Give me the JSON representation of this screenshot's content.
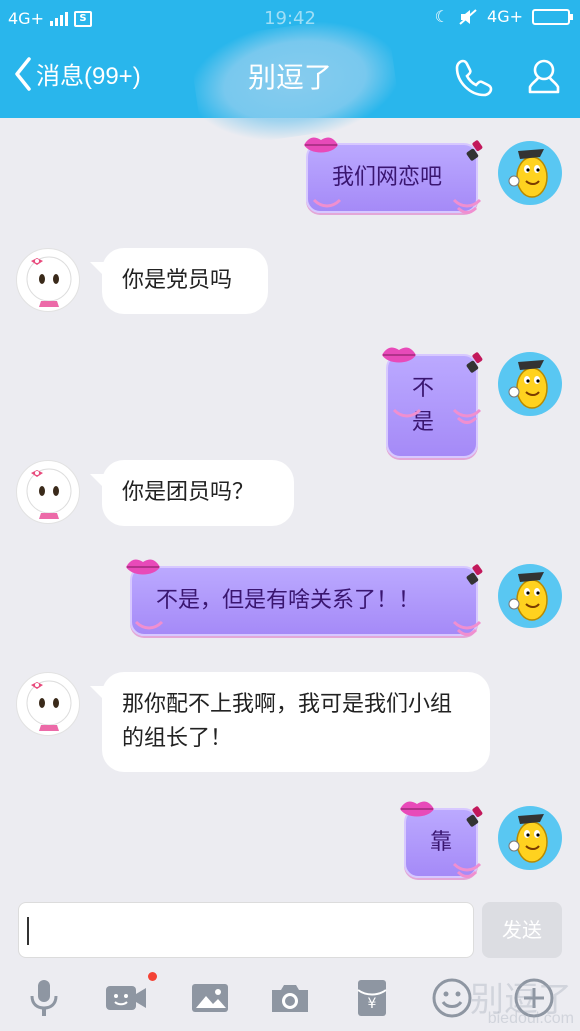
{
  "status_bar": {
    "network_left": "4G+",
    "time": "19:42",
    "network_right": "4G+"
  },
  "header": {
    "back_label": "消息(99+)",
    "title": "别逗了",
    "accent_color": "#29b6ec"
  },
  "messages": [
    {
      "side": "out",
      "text": "我们网恋吧"
    },
    {
      "side": "in",
      "text": "你是党员吗"
    },
    {
      "side": "out",
      "text": "不是"
    },
    {
      "side": "in",
      "text": "你是团员吗？"
    },
    {
      "side": "out",
      "text": "不是，但是有啥关系了！！"
    },
    {
      "side": "in",
      "text": "那你配不上我啊，我可是我们小组的组长了！"
    },
    {
      "side": "out",
      "text": "靠"
    }
  ],
  "input": {
    "value": "",
    "send_label": "发送"
  },
  "toolbar": {
    "icons": [
      "microphone-icon",
      "video-icon",
      "image-icon",
      "camera-icon",
      "red-envelope-icon",
      "emoji-icon",
      "plus-icon"
    ],
    "video_badge_color": "#f44336"
  },
  "watermark": {
    "text": "别逗了",
    "url": "biedoul.com"
  }
}
